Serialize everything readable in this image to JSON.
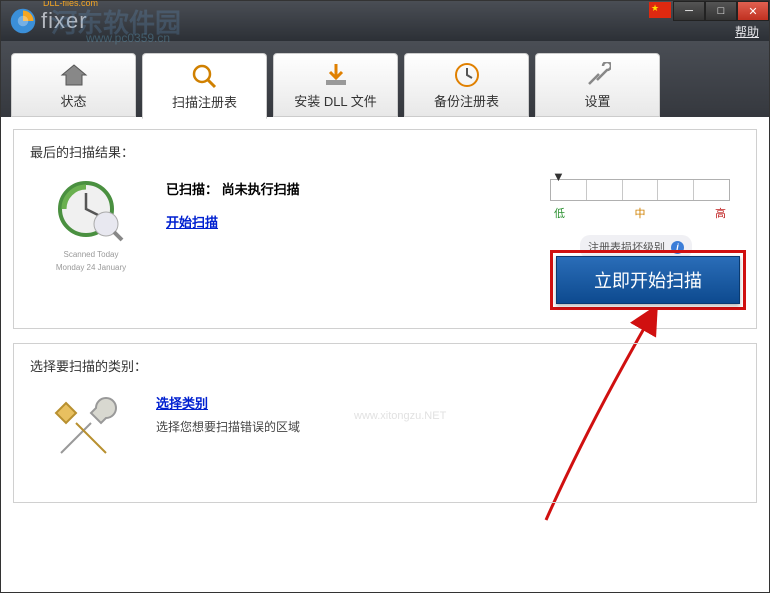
{
  "titlebar": {
    "brand": "fixer",
    "brand_sub": "DLL-files.com",
    "help": "帮助"
  },
  "watermark": {
    "main": "河东软件园",
    "sub": "www.pc0359.cn",
    "center": "www.xitongzu.NET"
  },
  "tabs": {
    "status": "状态",
    "scan": "扫描注册表",
    "install": "安装 DLL 文件",
    "backup": "备份注册表",
    "settings": "设置"
  },
  "scan_panel": {
    "title": "最后的扫描结果：",
    "scanned_label": "已扫描：",
    "scanned_value": "尚未执行扫描",
    "start_link": "开始扫描",
    "icon_sub1": "Scanned Today",
    "icon_sub2": "Monday 24 January"
  },
  "gauge": {
    "low": "低",
    "mid": "中",
    "high": "高",
    "caption": "注册表损坏级别",
    "marker": "▼"
  },
  "cta": {
    "label": "立即开始扫描"
  },
  "category_panel": {
    "title": "选择要扫描的类别：",
    "link": "选择类别",
    "desc": "选择您想要扫描错误的区域"
  }
}
